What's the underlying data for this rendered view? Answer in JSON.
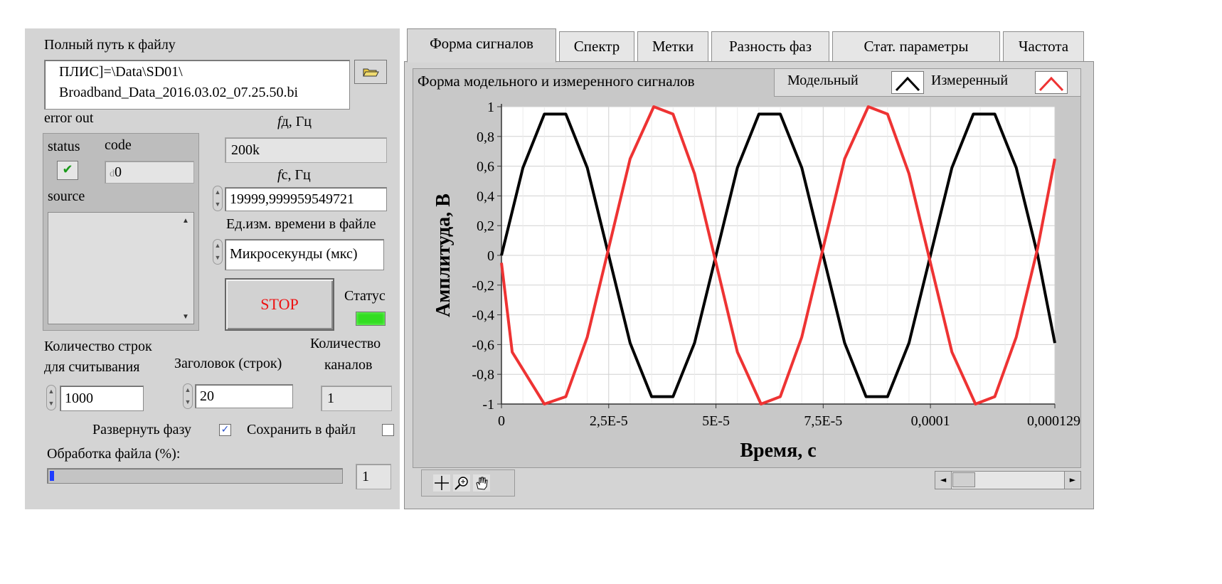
{
  "file_path": {
    "label": "Полный путь к файлу",
    "line1": "ПЛИС]=\\Data\\SD01\\",
    "line2": "Broadband_Data_2016.03.02_07.25.50.bi"
  },
  "error_out": {
    "label": "error out",
    "status_label": "status",
    "code_label": "code",
    "code_value": "0",
    "code_prefix": "d",
    "source_label": "source",
    "status_glyph": "✔"
  },
  "fd": {
    "label_italic": "f",
    "label_rest": "д, Гц",
    "value": "200k"
  },
  "fc": {
    "label_italic": "f",
    "label_rest": "с, Гц",
    "value": "19999,999959549721"
  },
  "time_unit": {
    "label": "Ед.изм. времени в файле",
    "value": "Микросекунды (мкс)"
  },
  "stop_button": {
    "label": "STOP"
  },
  "status_led": {
    "label": "Статус",
    "color": "#33dd22"
  },
  "rows": {
    "label_line1": "Количество строк",
    "label_line2": "для считывания",
    "value": "1000"
  },
  "header_rows": {
    "label": "Заголовок (строк)",
    "value": "20"
  },
  "channels": {
    "label_line1": "Количество",
    "label_line2": "каналов",
    "value": "1"
  },
  "unwrap_phase": {
    "label": "Развернуть фазу",
    "checked": true,
    "glyph": "✓"
  },
  "save_to_file": {
    "label": "Сохранить в файл",
    "checked": false
  },
  "processing": {
    "label": "Обработка файла (%):",
    "value": "1",
    "progress_percent": 1
  },
  "tabs": [
    "Форма сигналов",
    "Спектр",
    "Метки",
    "Разность фаз",
    "Стат. параметры",
    "Частота"
  ],
  "chart_title": "Форма модельного и измеренного сигналов",
  "legend": {
    "model_label": "Модельный",
    "measured_label": "Измеренный",
    "model_color": "#000000",
    "measured_color": "#ee3333"
  },
  "scrollbar": {
    "left_arrow": "◄",
    "right_arrow": "►"
  },
  "chart_data": {
    "type": "line",
    "xlabel": "Время, с",
    "ylabel": "Амплитуда, В",
    "xlim": [
      0,
      0.000129
    ],
    "ylim": [
      -1,
      1
    ],
    "x_ticks": [
      0,
      2.5e-05,
      5e-05,
      7.5e-05,
      0.0001,
      0.000129
    ],
    "x_tick_labels": [
      "0",
      "2,5E-5",
      "5E-5",
      "7,5E-5",
      "0,0001",
      "0,000129"
    ],
    "y_ticks": [
      1,
      0.8,
      0.6,
      0.4,
      0.2,
      0,
      -0.2,
      -0.4,
      -0.6,
      -0.8,
      -1
    ],
    "y_tick_labels": [
      "1",
      "0,8",
      "0,6",
      "0,4",
      "0,2",
      "0",
      "-0,2",
      "-0,4",
      "-0,6",
      "-0,8",
      "-1"
    ],
    "grid": true,
    "series": [
      {
        "name": "Модельный",
        "color": "#000000",
        "x": [
          0,
          5e-06,
          1e-05,
          1.5e-05,
          2e-05,
          2.5e-05,
          3e-05,
          3.5e-05,
          4e-05,
          4.5e-05,
          5e-05,
          5.5e-05,
          6e-05,
          6.5e-05,
          7e-05,
          7.5e-05,
          8e-05,
          8.5e-05,
          9e-05,
          9.5e-05,
          0.0001,
          0.000105,
          0.00011,
          0.000115,
          0.00012,
          0.000125,
          0.000129
        ],
        "y": [
          0,
          0.59,
          0.95,
          0.95,
          0.59,
          0,
          -0.59,
          -0.95,
          -0.95,
          -0.59,
          0,
          0.59,
          0.95,
          0.95,
          0.59,
          0,
          -0.59,
          -0.95,
          -0.95,
          -0.59,
          0,
          0.59,
          0.95,
          0.95,
          0.59,
          0,
          -0.59
        ]
      },
      {
        "name": "Измеренный",
        "color": "#ee3333",
        "x": [
          0,
          2.5e-06,
          1e-05,
          1.5e-05,
          2e-05,
          2.5e-05,
          3e-05,
          3.55e-05,
          4e-05,
          4.5e-05,
          5e-05,
          5.5e-05,
          6.05e-05,
          6.5e-05,
          7e-05,
          7.5e-05,
          8e-05,
          8.55e-05,
          9e-05,
          9.5e-05,
          0.0001,
          0.000105,
          0.0001105,
          0.000115,
          0.00012,
          0.000125,
          0.000129
        ],
        "y": [
          -0.05,
          -0.65,
          -1,
          -0.95,
          -0.55,
          0.05,
          0.65,
          1,
          0.95,
          0.55,
          -0.05,
          -0.65,
          -1,
          -0.95,
          -0.55,
          0.05,
          0.65,
          1,
          0.95,
          0.55,
          -0.05,
          -0.65,
          -1,
          -0.95,
          -0.55,
          0.05,
          0.65
        ]
      }
    ]
  }
}
